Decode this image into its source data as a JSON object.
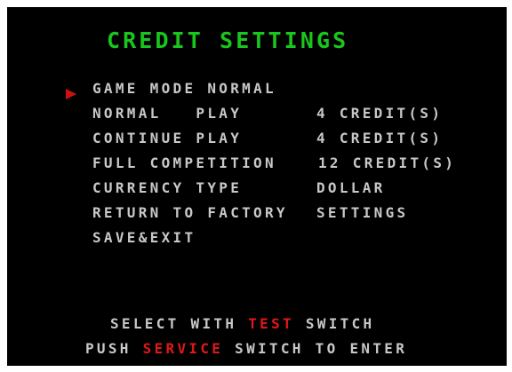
{
  "screen": {
    "title": "CREDIT SETTINGS"
  },
  "menu": {
    "items": [
      {
        "label": "GAME MODE NORMAL",
        "value": ""
      },
      {
        "label": "NORMAL   PLAY",
        "value": "4 CREDIT(S)"
      },
      {
        "label": "CONTINUE PLAY",
        "value": "4 CREDIT(S)"
      },
      {
        "label": "FULL COMPETITION",
        "value": "12 CREDIT(S)"
      },
      {
        "label": "CURRENCY TYPE",
        "value": "DOLLAR"
      },
      {
        "label": "RETURN TO FACTORY",
        "value": "SETTINGS"
      },
      {
        "label": "SAVE&EXIT",
        "value": ""
      }
    ],
    "selected_index": 0
  },
  "footer": {
    "line1_prefix": "SELECT WITH ",
    "line1_highlight": "TEST",
    "line1_suffix": " SWITCH",
    "line2_prefix": "PUSH ",
    "line2_highlight": "SERVICE",
    "line2_suffix": " SWITCH TO ENTER"
  },
  "colors": {
    "background": "#000000",
    "title": "#19c61d",
    "text": "#c8c8c8",
    "highlight": "#e01818",
    "cursor": "#d01010"
  }
}
